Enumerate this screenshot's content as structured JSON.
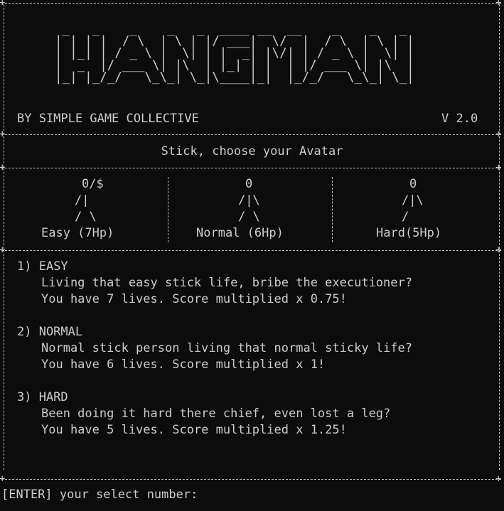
{
  "logo": {
    "art": [
      " _   _    _    _   _  ____ __  __    _    _   _ ",
      "| | | |  / \\  | \\ | |/ ___|  \\/  |  / \\  | \\ | |",
      "| |_| | / _ \\ |  \\| | |  _| |\\/| | / _ \\ |  \\| |",
      "|  _  |/ ___ \\| |\\  | |_| | |  | |/ ___ \\| |\\  |",
      "|_| |_/_/   \\_\\_| \\_|\\____|_|  |_/_/   \\_\\_| \\_|"
    ]
  },
  "header": {
    "credit": "BY SIMPLE GAME COLLECTIVE",
    "version": "V 2.0",
    "subtitle": "Stick, choose your Avatar"
  },
  "avatars": [
    {
      "art_lines": [
        "0/$",
        "/|",
        "/ \\"
      ],
      "label": "Easy (7Hp)"
    },
    {
      "art_lines": [
        "0",
        "/|\\",
        "/ \\"
      ],
      "label": "Normal (6Hp)"
    },
    {
      "art_lines": [
        "0",
        "/|\\",
        "/"
      ],
      "label": "Hard(5Hp)"
    }
  ],
  "options": [
    {
      "heading": "1) EASY",
      "description": "Living that easy stick life, bribe the executioner?",
      "details": "You have 7 lives. Score multiplied x 0.75!"
    },
    {
      "heading": "2) NORMAL",
      "description": "Normal stick person living that normal sticky life?",
      "details": "You have 6 lives. Score multiplied x 1!"
    },
    {
      "heading": "3) HARD",
      "description": "Been doing it hard there chief, even lost a leg?",
      "details": "You have 5 lives. Score multiplied x 1.25!"
    }
  ],
  "prompt": {
    "text": "[ENTER] your select number:"
  },
  "colors": {
    "background": "#0c0c0c",
    "foreground": "#cccccc"
  }
}
